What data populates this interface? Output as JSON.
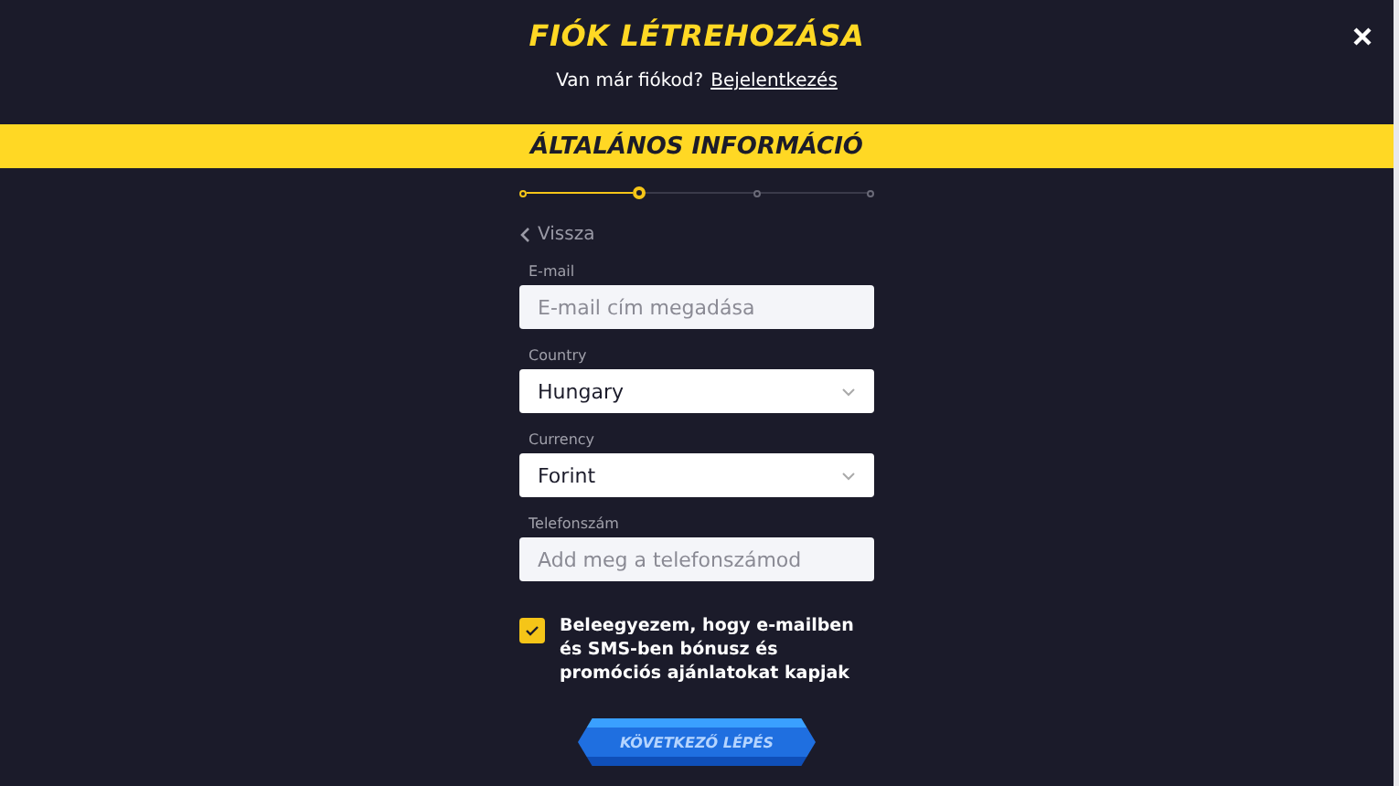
{
  "header": {
    "title": "FIÓK LÉTREHOZÁSA",
    "prompt": "Van már fiókod?",
    "login_link": "Bejelentkezés"
  },
  "section_title": "ÁLTALÁNOS INFORMÁCIÓ",
  "steps": [
    {
      "done": true,
      "selected": false
    },
    {
      "done": true,
      "selected": true
    },
    {
      "done": false,
      "selected": false
    },
    {
      "done": false,
      "selected": false
    }
  ],
  "back": "Vissza",
  "fields": [
    {
      "kind": "input",
      "label": "E-mail",
      "placeholder": "E-mail cím megadása"
    },
    {
      "kind": "select",
      "label": "Country",
      "value": "Hungary"
    },
    {
      "kind": "select",
      "label": "Currency",
      "value": "Forint"
    },
    {
      "kind": "input",
      "label": "Telefonszám",
      "placeholder": "Add meg a telefonszámod"
    }
  ],
  "consent": {
    "checked": true,
    "text": "Beleegyezem, hogy e-mailben és SMS-ben bónusz és promóciós ajánlatokat kapjak"
  },
  "next_button": {
    "label": "KÖVETKEZŐ LÉPÉS",
    "disabled": true
  }
}
